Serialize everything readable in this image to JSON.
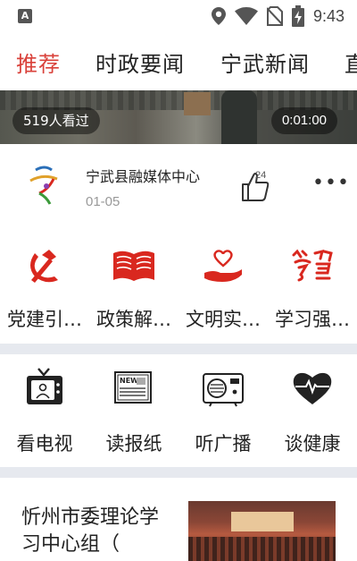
{
  "status_bar": {
    "left_icon": "A",
    "time": "9:43",
    "icons": [
      "location-icon",
      "wifi-icon",
      "no-sim-icon",
      "battery-charging-icon"
    ]
  },
  "tabs": [
    {
      "label": "推荐",
      "active": true
    },
    {
      "label": "时政要闻",
      "active": false
    },
    {
      "label": "宁武新闻",
      "active": false
    },
    {
      "label": "直",
      "active": false
    }
  ],
  "colors": {
    "accent": "#d9413a",
    "divider": "#e6e9ef",
    "icon_red": "#d9281f"
  },
  "video": {
    "views": "519人看过",
    "duration": "0:01:00"
  },
  "source": {
    "name": "宁武县融媒体中心",
    "date": "01-05",
    "likes": "24"
  },
  "categories_row1": [
    {
      "label": "党建引…",
      "icon": "hammer-sickle-icon"
    },
    {
      "label": "政策解…",
      "icon": "open-book-icon"
    },
    {
      "label": "文明实…",
      "icon": "heart-hand-icon"
    },
    {
      "label": "学习强…",
      "icon": "xuexi-calligraphy-icon"
    }
  ],
  "categories_row2": [
    {
      "label": "看电视",
      "icon": "tv-icon"
    },
    {
      "label": "读报纸",
      "icon": "newspaper-icon",
      "icon_text": "NEWS"
    },
    {
      "label": "听广播",
      "icon": "radio-icon"
    },
    {
      "label": "谈健康",
      "icon": "heartbeat-icon"
    }
  ],
  "article": {
    "title": "忻州市委理论学习中心组（"
  }
}
